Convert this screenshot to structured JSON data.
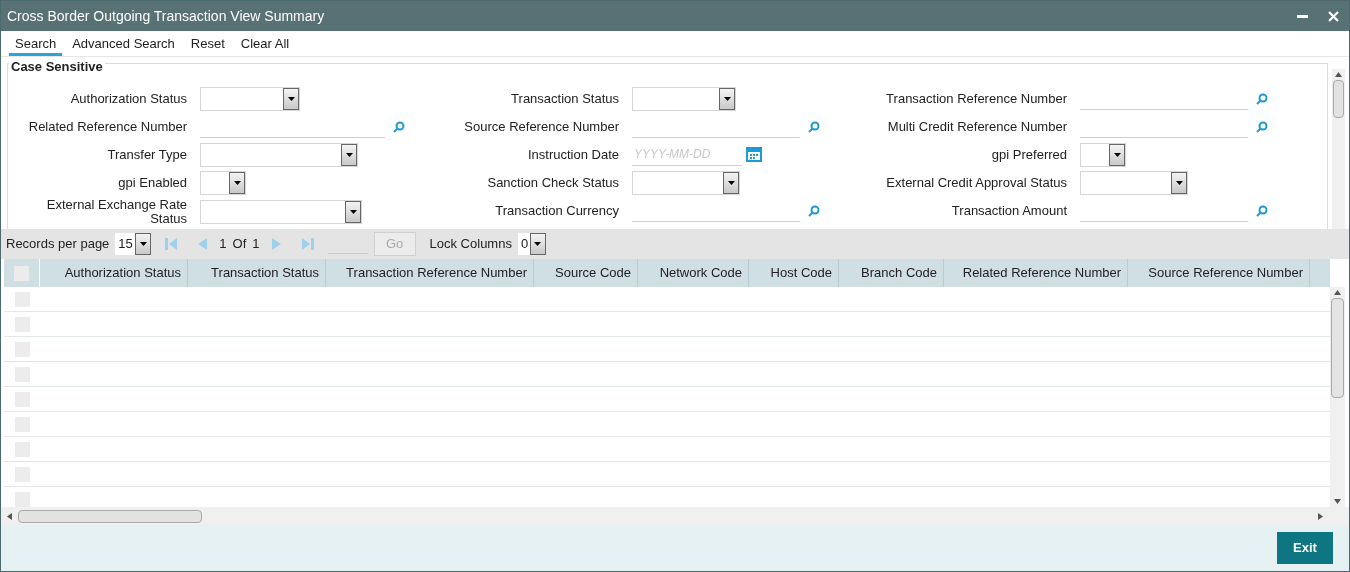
{
  "window": {
    "title": "Cross Border Outgoing Transaction View Summary"
  },
  "toolbar": [
    {
      "label": "Search",
      "selected": true
    },
    {
      "label": "Advanced Search",
      "selected": false
    },
    {
      "label": "Reset",
      "selected": false
    },
    {
      "label": "Clear All",
      "selected": false
    }
  ],
  "form": {
    "legend": "Case Sensitive",
    "columns": [
      [
        {
          "label": "Authorization Status",
          "kind": "select"
        },
        {
          "label": "Related Reference Number",
          "kind": "lookup"
        },
        {
          "label": "Transfer Type",
          "kind": "select"
        },
        {
          "label": "gpi Enabled",
          "kind": "select"
        },
        {
          "label": "External Exchange Rate Status",
          "kind": "select"
        }
      ],
      [
        {
          "label": "Transaction Status",
          "kind": "select"
        },
        {
          "label": "Source Reference Number",
          "kind": "lookup"
        },
        {
          "label": "Instruction Date",
          "kind": "date",
          "placeholder": "YYYY-MM-DD"
        },
        {
          "label": "Sanction Check Status",
          "kind": "select"
        },
        {
          "label": "Transaction Currency",
          "kind": "lookup"
        }
      ],
      [
        {
          "label": "Transaction Reference Number",
          "kind": "lookup"
        },
        {
          "label": "Multi Credit Reference Number",
          "kind": "lookup"
        },
        {
          "label": "gpi Preferred",
          "kind": "select"
        },
        {
          "label": "External Credit Approval Status",
          "kind": "select"
        },
        {
          "label": "Transaction Amount",
          "kind": "lookup"
        }
      ]
    ]
  },
  "pager": {
    "records_label": "Records per page",
    "records_value": "15",
    "page": "1",
    "of_label": "Of",
    "total": "1",
    "go": "Go",
    "go_disabled": true,
    "lock_label": "Lock Columns",
    "lock_value": "0"
  },
  "table": {
    "columns": [
      "Authorization Status",
      "Transaction Status",
      "Transaction Reference Number",
      "Source Code",
      "Network Code",
      "Host Code",
      "Branch Code",
      "Related Reference Number",
      "Source Reference Number"
    ],
    "select_all_checked": false,
    "rows": [
      {
        "checked": false
      },
      {
        "checked": false
      },
      {
        "checked": false
      },
      {
        "checked": false
      },
      {
        "checked": false
      },
      {
        "checked": false
      },
      {
        "checked": false
      },
      {
        "checked": false
      },
      {
        "checked": false
      }
    ]
  },
  "footer": {
    "exit": "Exit"
  }
}
